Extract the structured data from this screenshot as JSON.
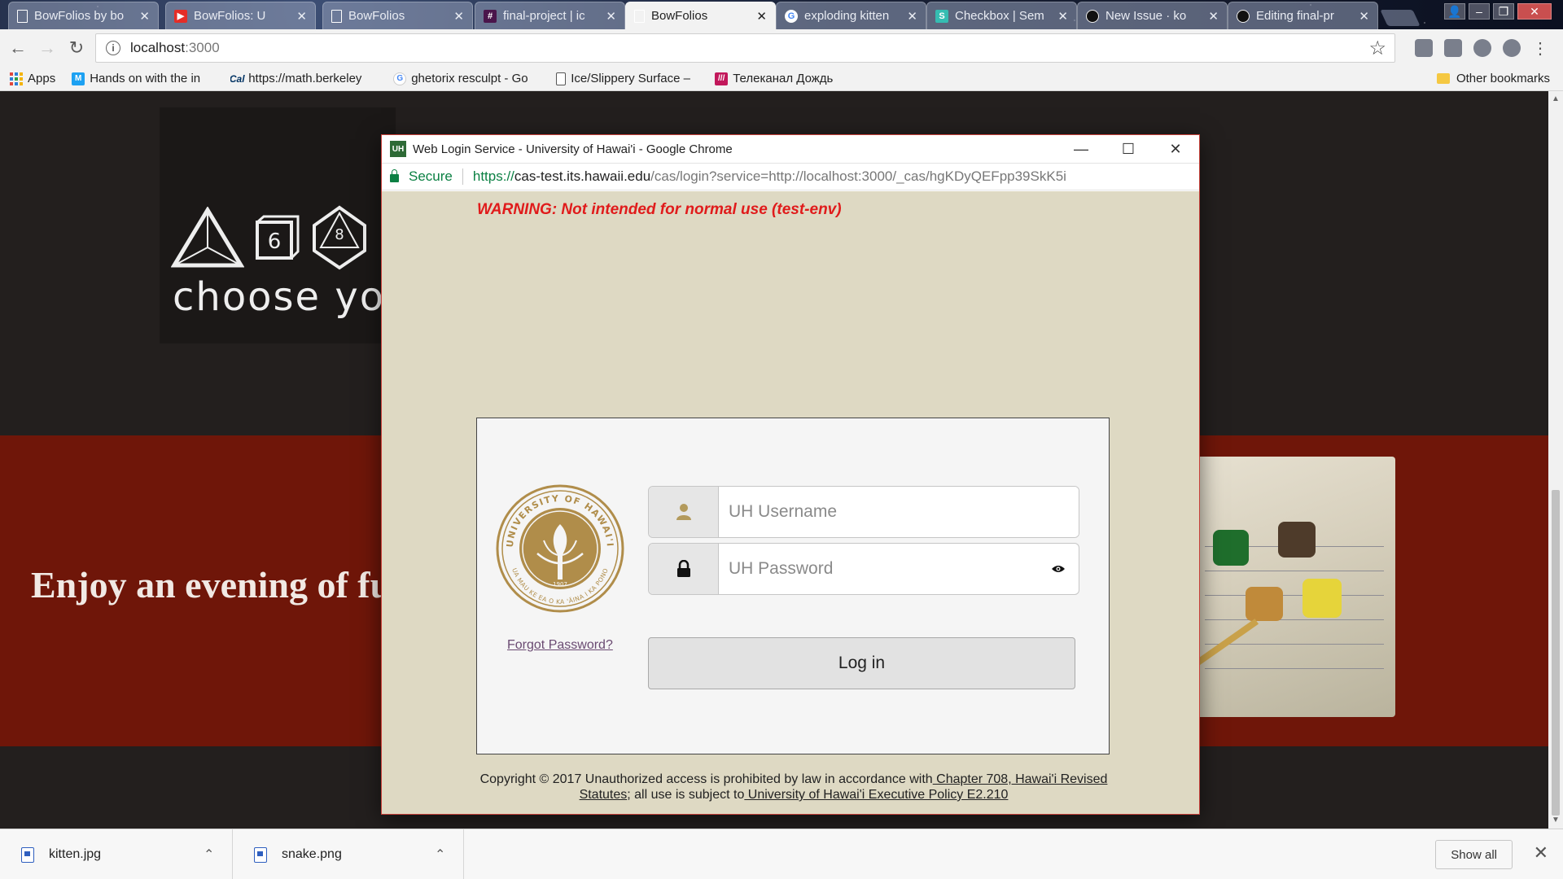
{
  "browser": {
    "tabs": [
      {
        "label": "BowFolios by bo",
        "icon": "document-icon"
      },
      {
        "label": "BowFolios: U",
        "icon": "youtube-icon"
      },
      {
        "label": "BowFolios",
        "icon": "document-icon"
      },
      {
        "label": "final-project | ic",
        "icon": "slack-icon"
      },
      {
        "label": "BowFolios",
        "icon": "document-icon",
        "active": true
      },
      {
        "label": "exploding kitten",
        "icon": "google-icon"
      },
      {
        "label": "Checkbox | Sem",
        "icon": "semantic-icon"
      },
      {
        "label": "New Issue · ko",
        "icon": "github-icon"
      },
      {
        "label": "Editing final-pr",
        "icon": "github-icon"
      }
    ],
    "address": {
      "host": "localhost",
      "port": ":3000"
    },
    "bookmarks": [
      {
        "label": "Apps",
        "icon": "apps-icon"
      },
      {
        "label": "Hands on with the in",
        "icon": "bookmark-m-icon"
      },
      {
        "label": "https://math.berkeley",
        "icon": "berkeley-icon"
      },
      {
        "label": "ghetorix resculpt - Go",
        "icon": "google-icon"
      },
      {
        "label": "Ice/Slippery Surface –",
        "icon": "document-icon"
      },
      {
        "label": "Телеканал Дождь",
        "icon": "dozhd-icon"
      }
    ],
    "other_bookmarks": "Other bookmarks"
  },
  "page": {
    "tagline": "choose you",
    "enjoy": "Enjoy an evening of fu"
  },
  "popup": {
    "window_title": "Web Login Service - University of Hawai'i - Google Chrome",
    "favicon_text": "UH",
    "secure_label": "Secure",
    "url_scheme": "https://",
    "url_host": "cas-test.its.hawaii.edu",
    "url_path": "/cas/login?service=http://localhost:3000/_cas/hgKDyQEFpp39SkK5i",
    "warning": "WARNING: Not intended for normal use (test-env)",
    "username_placeholder": "UH Username",
    "password_placeholder": "UH Password",
    "forgot_password": "Forgot Password?",
    "login_button": "Log in",
    "seal": {
      "top_text": "UNIVERSITY OF HAWAI'I",
      "bottom_text": "UA MAU KE EA O KA 'ĀINA I KA PONO",
      "year": "1907"
    },
    "copyright": {
      "prefix": "Copyright © 2017 Unauthorized access is prohibited by law in accordance with",
      "link1": " Chapter 708, Hawai'i Revised Statutes",
      "middle": "; all use is subject to",
      "link2": " University of Hawai'i Executive Policy E2.210"
    }
  },
  "downloads": {
    "items": [
      {
        "name": "kitten.jpg"
      },
      {
        "name": "snake.png"
      }
    ],
    "show_all": "Show all"
  }
}
